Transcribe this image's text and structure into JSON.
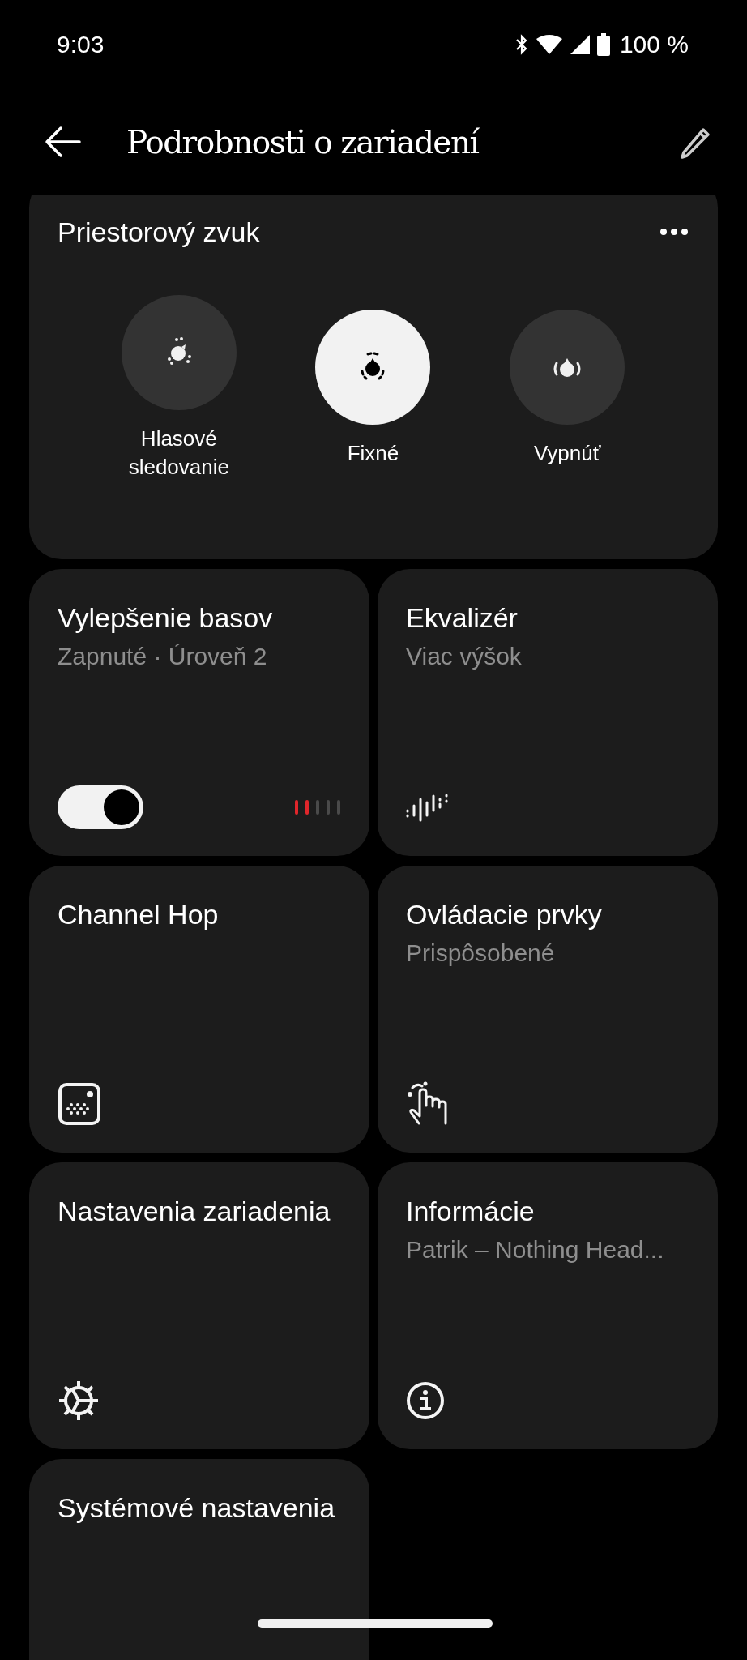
{
  "status_bar": {
    "time": "9:03",
    "battery": "100 %"
  },
  "app_bar": {
    "title": "Podrobnosti o zariadení"
  },
  "spatial_audio": {
    "title": "Priestorový zvuk",
    "options": [
      {
        "label": "Hlasové sledovanie",
        "kind": "tracking",
        "selected": false
      },
      {
        "label": "Fixné",
        "kind": "fixed",
        "selected": true
      },
      {
        "label": "Vypnúť",
        "kind": "off",
        "selected": false
      }
    ]
  },
  "cards": [
    {
      "title": "Vylepšenie basov",
      "subtitle": "Zapnuté · Úroveň 2",
      "kind": "bass",
      "on": true,
      "level": 0.4
    },
    {
      "title": "Ekvalizér",
      "subtitle": "Viac výšok",
      "kind": "equalizer"
    },
    {
      "title": "Channel Hop",
      "kind": "dice"
    },
    {
      "title": "Ovládacie prvky",
      "subtitle": "Prispôsobené",
      "kind": "gesture"
    },
    {
      "title": "Nastavenia zariadenia",
      "kind": "gear"
    },
    {
      "title": "Informácie",
      "subtitle": "Patrik – Nothing Head...",
      "kind": "info"
    },
    {
      "title": "Systémové nastavenia",
      "kind": "plain"
    }
  ]
}
